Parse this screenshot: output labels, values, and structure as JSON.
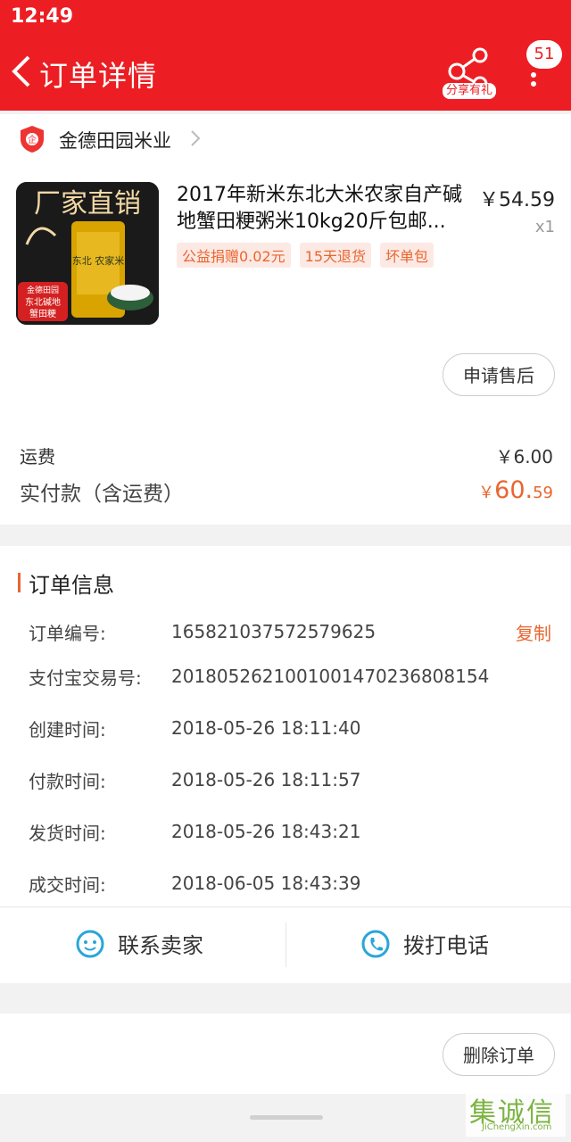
{
  "status": {
    "time": "12:49"
  },
  "header": {
    "title": "订单详情",
    "share_label": "分享有礼",
    "msg_count": "51"
  },
  "shop": {
    "name": "金德田园米业"
  },
  "product": {
    "title": "2017年新米东北大米农家自产碱地蟹田粳粥米10kg20斤包邮...",
    "price": "￥54.59",
    "qty": "x1",
    "tags": [
      "公益捐赠0.02元",
      "15天退货",
      "坏单包"
    ],
    "image_text": {
      "banner": "厂家直销",
      "bag": "东北 农家米",
      "badge_top": "金德田园",
      "badge_mid": "东北碱地",
      "badge_bottom": "蟹田粳"
    }
  },
  "actions": {
    "after_sales": "申请售后",
    "delete_order": "删除订单"
  },
  "summary": {
    "shipping_label": "运费",
    "shipping_value": "￥6.00",
    "paid_label": "实付款（含运费）",
    "paid_currency": "￥",
    "paid_int": "60.",
    "paid_dec": "59"
  },
  "order_info": {
    "title": "订单信息",
    "copy": "复制",
    "rows": [
      {
        "label": "订单编号:",
        "value": "165821037572579625"
      },
      {
        "label": "支付宝交易号:",
        "value": "2018052621001001470236808154"
      },
      {
        "label": "创建时间:",
        "value": "2018-05-26 18:11:40"
      },
      {
        "label": "付款时间:",
        "value": "2018-05-26 18:11:57"
      },
      {
        "label": "发货时间:",
        "value": "2018-05-26 18:43:21"
      },
      {
        "label": "成交时间:",
        "value": "2018-06-05 18:43:39"
      }
    ]
  },
  "contact": {
    "seller": "联系卖家",
    "call": "拨打电话"
  },
  "watermark": {
    "text": "集诚信",
    "sub": "JiChengXin.com"
  },
  "colors": {
    "brand_red": "#ec1e23",
    "accent_orange": "#e8662f"
  }
}
